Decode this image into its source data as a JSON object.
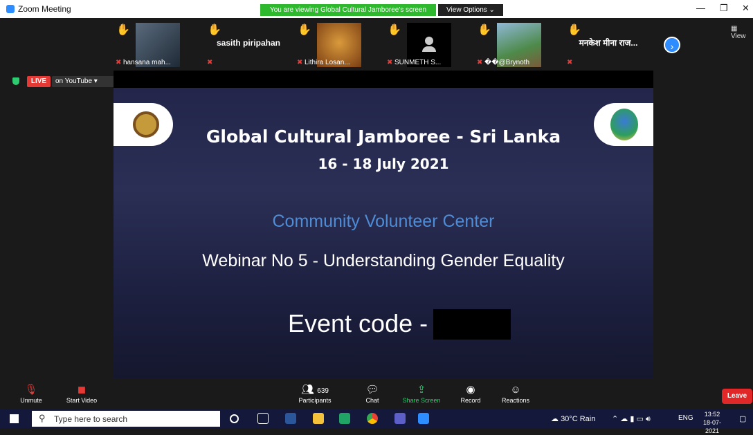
{
  "window": {
    "title": "Zoom Meeting",
    "share_banner": "You are viewing Global Cultural Jamboree's screen",
    "view_options": "View Options ⌄",
    "minimize": "—",
    "restore": "❐",
    "close": "✕"
  },
  "gallery": {
    "participants": [
      {
        "name": "hansana mah...",
        "display": "photo"
      },
      {
        "name": "",
        "display": "sasith piripahan"
      },
      {
        "name": "Lithira Losan...",
        "display": "photo"
      },
      {
        "name": "SUNMETH S...",
        "display": "avatar"
      },
      {
        "name": "��@Brynoth",
        "display": "photo"
      },
      {
        "name": "",
        "display": "मनकेश मीना राज..."
      }
    ],
    "next_label": "›",
    "view_label": "View"
  },
  "live": {
    "badge": "LIVE",
    "platform": "on YouTube ▾"
  },
  "slide": {
    "title": "Global Cultural Jamboree - Sri Lanka",
    "dates": "16 - 18 July 2021",
    "subtitle": "Community Volunteer Center",
    "webinar": "Webinar No 5 - Understanding Gender Equality",
    "event_code": "Event code -"
  },
  "controls": {
    "unmute": "Unmute",
    "start_video": "Start Video",
    "participants": "Participants",
    "participant_count": "639",
    "chat": "Chat",
    "share_screen": "Share Screen",
    "record": "Record",
    "reactions": "Reactions",
    "leave": "Leave"
  },
  "taskbar": {
    "search_placeholder": "Type here to search",
    "weather": "30°C  Rain",
    "language": "ENG",
    "time": "13:52",
    "date": "18-07-2021"
  },
  "colors": {
    "zoom_blue": "#2d8cff",
    "share_green": "#2eb82e",
    "leave_red": "#e02828",
    "live_red": "#e53935"
  }
}
